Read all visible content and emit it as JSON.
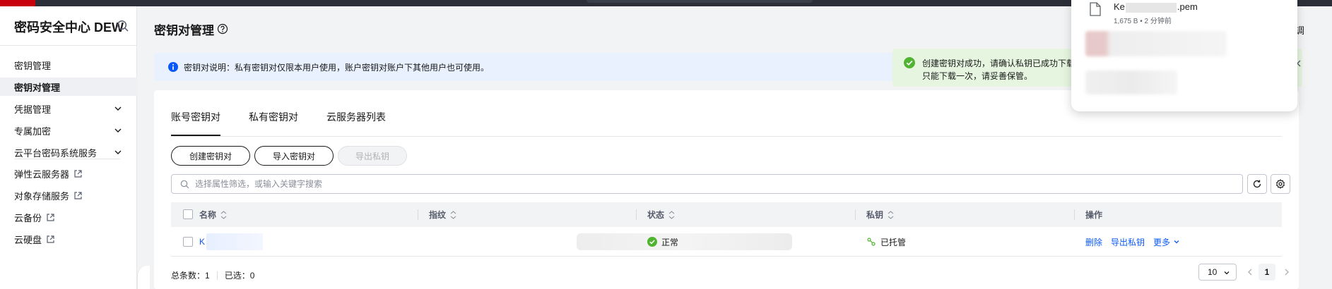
{
  "sidebar": {
    "title": "密码安全中心 DEW",
    "items": [
      {
        "label": "密钥管理",
        "active": false,
        "expandable": false,
        "external": false
      },
      {
        "label": "密钥对管理",
        "active": true,
        "expandable": false,
        "external": false
      },
      {
        "label": "凭据管理",
        "active": false,
        "expandable": true,
        "external": false
      },
      {
        "label": "专属加密",
        "active": false,
        "expandable": true,
        "external": false
      },
      {
        "label": "云平台密码系统服务",
        "active": false,
        "expandable": true,
        "external": false
      },
      {
        "label": "弹性云服务器",
        "active": false,
        "expandable": false,
        "external": true
      },
      {
        "label": "对象存储服务",
        "active": false,
        "expandable": false,
        "external": true
      },
      {
        "label": "云备份",
        "active": false,
        "expandable": false,
        "external": true
      },
      {
        "label": "云硬盘",
        "active": false,
        "expandable": false,
        "external": true
      }
    ]
  },
  "header": {
    "title": "密钥对管理",
    "right_label": "调"
  },
  "info": {
    "text": "密钥对说明：私有密钥对仅限本用户使用，账户密钥对账户下其他用户也可使用。"
  },
  "tabs": [
    {
      "label": "账号密钥对",
      "active": true
    },
    {
      "label": "私有密钥对",
      "active": false
    },
    {
      "label": "云服务器列表",
      "active": false
    }
  ],
  "toolbar": {
    "create_label": "创建密钥对",
    "import_label": "导入密钥对",
    "export_label": "导出私钥"
  },
  "search": {
    "placeholder": "选择属性筛选，或输入关键字搜索"
  },
  "table": {
    "columns": [
      "名称",
      "指纹",
      "状态",
      "私钥",
      "操作"
    ],
    "rows": [
      {
        "name": "K",
        "status": "正常",
        "private_key": "已托管",
        "actions": [
          "删除",
          "导出私钥",
          "更多"
        ]
      }
    ]
  },
  "footer": {
    "total_label": "总条数：1",
    "selected_label": "已选：0",
    "page_size": "10",
    "current_page": "1"
  },
  "toast": {
    "line1": "创建密钥对成功，请确认私钥已成功下载",
    "line2": "只能下载一次，请妥善保管。"
  },
  "download": {
    "file_prefix": "Ke",
    "file_suffix": ".pem",
    "meta": "1,675 B • 2 分钟前"
  },
  "colors": {
    "accent": "#0a59f7",
    "success": "#50b432",
    "info_bg": "#e8f1fd",
    "toast_bg": "#e5f5df",
    "brand": "#c7000b"
  }
}
